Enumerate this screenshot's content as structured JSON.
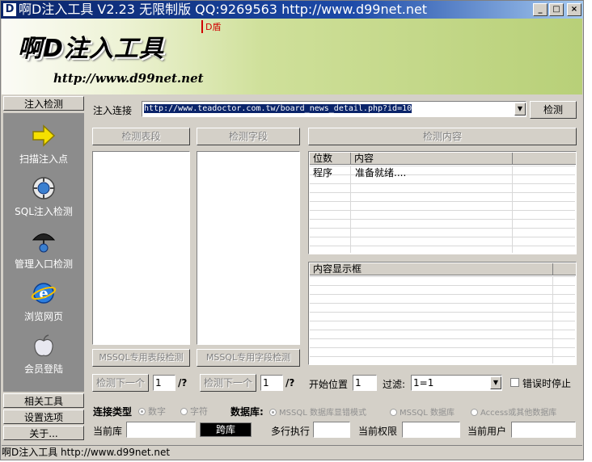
{
  "titlebar": {
    "icon_letter": "D",
    "title": "啊D注入工具 V2.23 无限制版 QQ:9269563 http://www.d99net.net",
    "min": "_",
    "max": "□",
    "close": "×"
  },
  "banner": {
    "logo": "啊D注入工具",
    "url": "http://www.d99net.net",
    "shield": "D盾"
  },
  "sidebar": {
    "top_button": "注入检测",
    "items": [
      {
        "label": "扫描注入点",
        "icon": "arrow-right-icon"
      },
      {
        "label": "SQL注入检测",
        "icon": "globe-gear-icon"
      },
      {
        "label": "管理入口检测",
        "icon": "umbrella-globe-icon"
      },
      {
        "label": "浏览网页",
        "icon": "ie-browser-icon"
      },
      {
        "label": "会员登陆",
        "icon": "apple-icon"
      }
    ],
    "bottom_buttons": [
      "相关工具",
      "设置选项",
      "关于..."
    ]
  },
  "main": {
    "inject_label": "注入连接",
    "inject_url": "http://www.teadoctor.com.tw/board_news_detail.php?id=10",
    "detect_button": "检测",
    "detect_table_btn": "检测表段",
    "detect_field_btn": "检测字段",
    "detect_content_btn": "检测内容",
    "results": {
      "columns": [
        "位数",
        "内容"
      ],
      "rows": [
        [
          "程序",
          "准备就绪...."
        ]
      ]
    },
    "content_box_header": "内容显示框",
    "mssql_table_btn": "MSSQL专用表段检测",
    "mssql_field_btn": "MSSQL专用字段检测",
    "next_table_btn": "检测下一个",
    "table_page": "1",
    "table_total": "/?",
    "next_field_btn": "检测下一个",
    "field_page": "1",
    "field_total": "/?",
    "start_pos_label": "开始位置",
    "start_pos": "1",
    "filter_label": "过滤:",
    "filter_value": "1=1",
    "stop_on_error": "错误时停止",
    "conn_type_label": "连接类型",
    "conn_types": [
      "数字",
      "字符"
    ],
    "db_label": "数据库:",
    "db_types": [
      "MSSQL 数据库显错模式",
      "MSSQL 数据库",
      "Access或其他数据库"
    ],
    "current_db_label": "当前库",
    "current_db": "",
    "cross_db_btn": "跨库",
    "multi_exec_label": "多行执行",
    "multi_exec": "",
    "current_perm_label": "当前权限",
    "current_perm": "",
    "current_user_label": "当前用户",
    "current_user": ""
  },
  "statusbar": {
    "text": "啊D注入工具 http://www.d99net.net"
  }
}
